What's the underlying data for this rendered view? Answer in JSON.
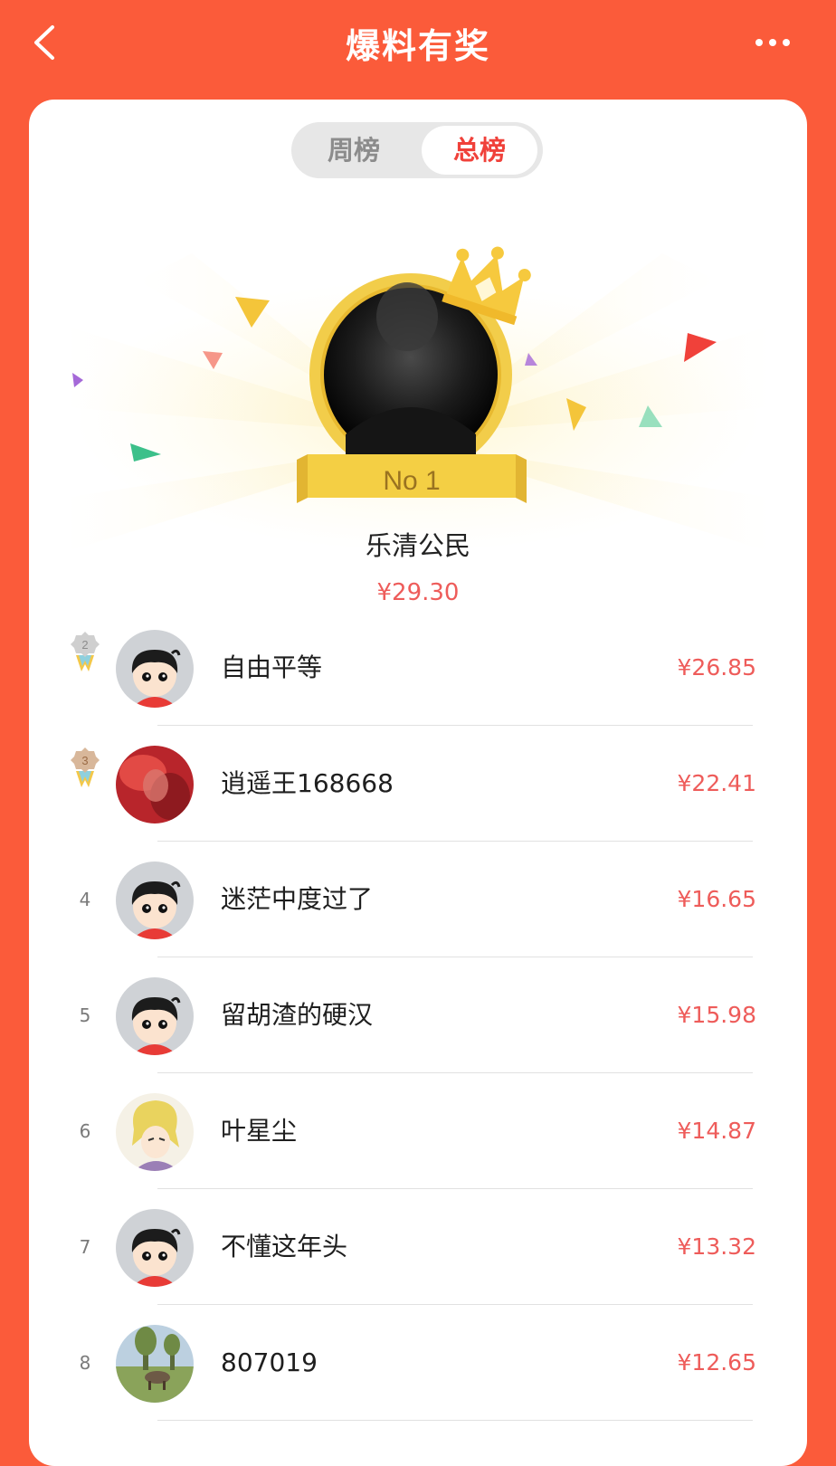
{
  "header": {
    "title": "爆料有奖",
    "back_icon": "chevron-left-icon",
    "more_icon": "more-dots-icon"
  },
  "tabs": {
    "weekly": "周榜",
    "total": "总榜",
    "selected": "总榜"
  },
  "colors": {
    "brand": "#fb5b3a",
    "accent_red": "#f0413a",
    "amount": "#ee5c5a",
    "gold": "#f2cd4a"
  },
  "winner": {
    "rank_label": "No 1",
    "name": "乐清公民",
    "amount": "¥29.30",
    "crown_icon": "crown-icon"
  },
  "rows": [
    {
      "rank": "2",
      "name": "自由平等",
      "amount": "¥26.85"
    },
    {
      "rank": "3",
      "name": "逍遥王168668",
      "amount": "¥22.41"
    },
    {
      "rank": "4",
      "name": "迷茫中度过了",
      "amount": "¥16.65"
    },
    {
      "rank": "5",
      "name": "留胡渣的硬汉",
      "amount": "¥15.98"
    },
    {
      "rank": "6",
      "name": "叶星尘",
      "amount": "¥14.87"
    },
    {
      "rank": "7",
      "name": "不懂这年头",
      "amount": "¥13.32"
    },
    {
      "rank": "8",
      "name": "807019",
      "amount": "¥12.65"
    }
  ]
}
